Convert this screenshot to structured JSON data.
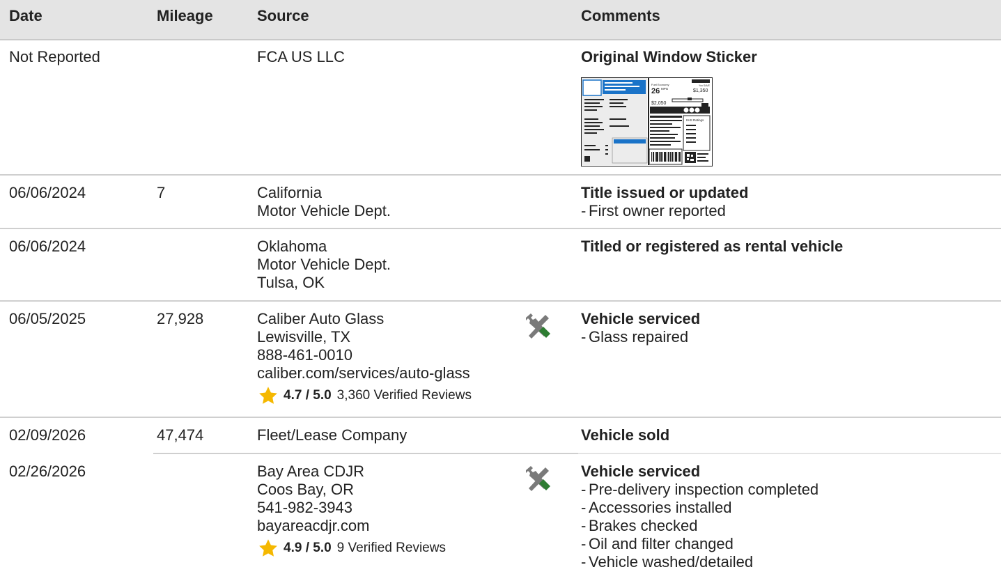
{
  "columns": {
    "date": "Date",
    "mileage": "Mileage",
    "source": "Source",
    "comments": "Comments"
  },
  "colors": {
    "header_bg": "#e4e4e4",
    "divider": "#cfcfcf",
    "star": "#f5b800",
    "tool_handle": "#2e7d32",
    "sticker_blue": "#1a73c8"
  },
  "rows": [
    {
      "date": "Not Reported",
      "mileage": "",
      "source": [
        "FCA US LLC"
      ],
      "comment_title": "Original Window Sticker",
      "comment_items": [],
      "sticker": {
        "mpg_value": "26",
        "mpg_unit": "MPG",
        "save_label": "You SAVE",
        "save_value": "$1,350",
        "spend_value": "$2,050",
        "ratings_label": "IIHS Ratings"
      }
    },
    {
      "date": "06/06/2024",
      "mileage": "7",
      "source": [
        "California",
        "Motor Vehicle Dept."
      ],
      "comment_title": "Title issued or updated",
      "comment_items": [
        "First owner reported"
      ]
    },
    {
      "date": "06/06/2024",
      "mileage": "",
      "source": [
        "Oklahoma",
        "Motor Vehicle Dept.",
        "Tulsa, OK"
      ],
      "comment_title": "Titled or registered as rental vehicle",
      "comment_items": []
    },
    {
      "date": "06/05/2025",
      "mileage": "27,928",
      "source": [
        "Caliber Auto Glass",
        "Lewisville, TX",
        "888-461-0010",
        "caliber.com/services/auto-glass"
      ],
      "rating": {
        "score": "4.7 / 5.0",
        "reviews": "3,360 Verified Reviews"
      },
      "icon": "service-tools-icon",
      "comment_title": "Vehicle serviced",
      "comment_items": [
        "Glass repaired"
      ]
    },
    {
      "date": "02/09/2026",
      "mileage": "47,474",
      "source": [
        "Fleet/Lease Company"
      ],
      "comment_title": "Vehicle sold",
      "comment_items": []
    },
    {
      "date": "02/26/2026",
      "mileage": "",
      "source": [
        "Bay Area CDJR",
        "Coos Bay, OR",
        "541-982-3943",
        "bayareacdjr.com"
      ],
      "rating": {
        "score": "4.9 / 5.0",
        "reviews": "9 Verified Reviews"
      },
      "icon": "service-tools-icon",
      "comment_title": "Vehicle serviced",
      "comment_items": [
        "Pre-delivery inspection completed",
        "Accessories installed",
        "Brakes checked",
        "Oil and filter changed",
        "Vehicle washed/detailed"
      ]
    }
  ]
}
